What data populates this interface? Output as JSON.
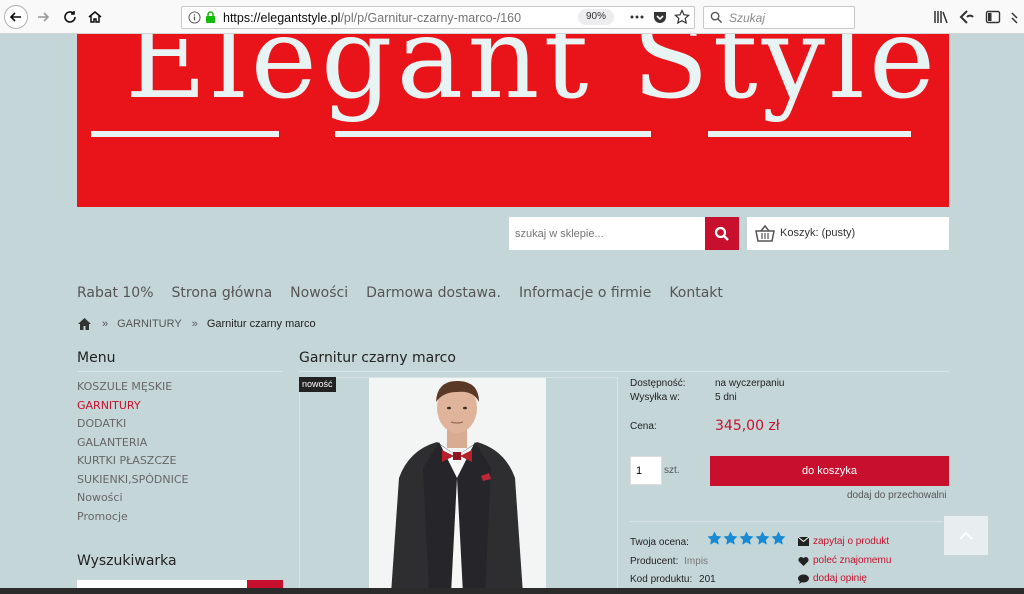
{
  "browser": {
    "url_host": "https://elegantstyle.pl",
    "url_path": "/pl/p/Garnitur-czarny-marco-/160",
    "zoom": "90%",
    "search_placeholder": "Szukaj"
  },
  "banner": {
    "text": "Elegant Style"
  },
  "shop": {
    "search_placeholder": "szukaj w sklepie...",
    "cart_label": "Koszyk: (pusty)"
  },
  "mainnav": [
    "Rabat 10%",
    "Strona główna",
    "Nowości",
    "Darmowa dostawa.",
    "Informacje o firmie",
    "Kontakt"
  ],
  "breadcrumb": {
    "category": "GARNITURY",
    "current": "Garnitur czarny marco",
    "separator": "»"
  },
  "sidebar": {
    "title": "Menu",
    "items": [
      "KOSZULE MĘSKIE",
      "GARNITURY",
      "DODATKI",
      "GALANTERIA",
      "KURTKI PŁASZCZE",
      "SUKIENKI,SPÓDNICE",
      "Nowości",
      "Promocje"
    ],
    "active_index": 1,
    "search_title": "Wyszukiwarka"
  },
  "product": {
    "title": "Garnitur czarny marco",
    "badge": "nowość",
    "availability_label": "Dostępność:",
    "availability_value": "na wyczerpaniu",
    "shipping_label": "Wysyłka w:",
    "shipping_value": "5 dni",
    "price_label": "Cena:",
    "price_value": "345,00 zł",
    "quantity": "1",
    "unit": "szt.",
    "add_to_cart": "do koszyka",
    "add_to_storage": "dodaj do przechowalni",
    "rating_label": "Twoja ocena:",
    "rating_stars": 5,
    "producer_label": "Producent:",
    "producer_value": "Impis",
    "code_label": "Kod produktu:",
    "code_value": "201",
    "actions": [
      "zapytaj o produkt",
      "poleć znajomemu",
      "dodaj opinię"
    ]
  },
  "colors": {
    "accent": "#c8102e",
    "page_bg": "#c5d6d8",
    "banner_bg": "#e8141a",
    "star": "#1a8ad4"
  }
}
